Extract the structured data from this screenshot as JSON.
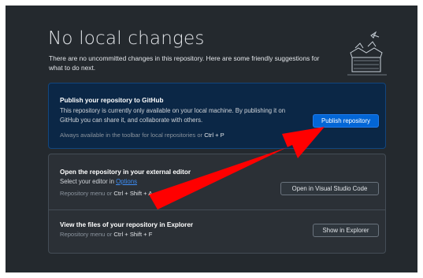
{
  "page": {
    "title": "No local changes",
    "subtitle": "There are no uncommitted changes in this repository. Here are some friendly suggestions for what to do next."
  },
  "publish": {
    "heading": "Publish your repository to GitHub",
    "description": "This repository is currently only available on your local machine. By publishing it on GitHub you can share it, and collaborate with others.",
    "hint_prefix": "Always available in the toolbar for local repositories or",
    "hint_keys": "Ctrl + P",
    "button_label": "Publish repository"
  },
  "editor": {
    "heading": "Open the repository in your external editor",
    "desc_prefix": "Select your editor in",
    "desc_link": "Options",
    "hint_prefix": "Repository menu or",
    "hint_keys": "Ctrl + Shift + A",
    "button_label": "Open in Visual Studio Code"
  },
  "explorer": {
    "heading": "View the files of your repository in Explorer",
    "hint_prefix": "Repository menu or",
    "hint_keys": "Ctrl + Shift + F",
    "button_label": "Show in Explorer"
  },
  "annotation": {
    "arrow_color": "#ff0000",
    "icon": "red-arrow-icon"
  },
  "colors": {
    "background": "#24292e",
    "publish_card": "#0b2746",
    "primary_button": "#0366d6",
    "link": "#3d8ef7"
  },
  "icons": [
    "empty-box-illustration-icon",
    "red-arrow-icon"
  ]
}
